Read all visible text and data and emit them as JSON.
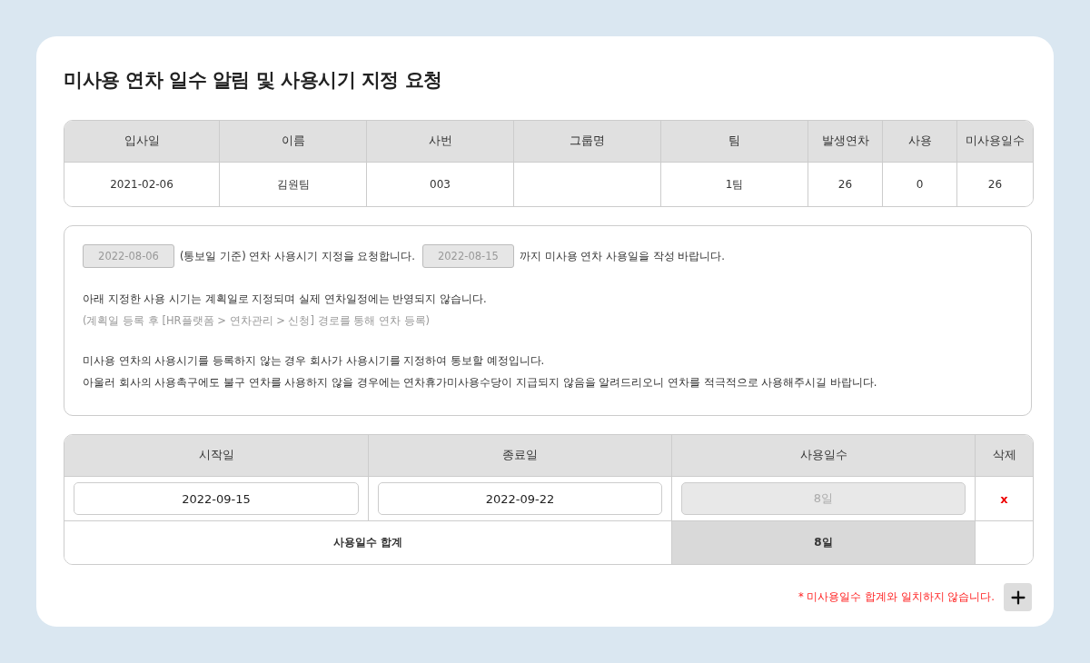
{
  "title": "미사용 연차 일수 알림 및 사용시기 지정 요청",
  "employee_table": {
    "columns": [
      "입사일",
      "이름",
      "사번",
      "그룹명",
      "팀",
      "발생연차",
      "사용",
      "미사용일수"
    ],
    "rows": [
      [
        "2021-02-06",
        "김원팀",
        "003",
        "",
        "1팀",
        "26",
        "0",
        "26"
      ]
    ]
  },
  "notice": {
    "request_line": {
      "notify_date": "2022-08-06",
      "text_1": "(통보일 기준) 연차 사용시기 지정을 요청합니다.",
      "deadline": "2022-08-15",
      "text_2": "까지 미사용 연차 사용일을 작성 바랍니다."
    },
    "groups": [
      {
        "lines": [
          {
            "text": "아래 지정한 사용 시기는 계획일로 지정되며 실제 연차일정에는 반영되지 않습니다.",
            "muted": false
          },
          {
            "text": "(계획일 등록 후 [HR플랫폼 > 연차관리 > 신청] 경로를 통해 연차 등록)",
            "muted": true
          }
        ]
      },
      {
        "lines": [
          {
            "text": "미사용 연차의 사용시기를 등록하지 않는 경우 회사가 사용시기를 지정하여 통보할 예정입니다.",
            "muted": false
          },
          {
            "text": "아울러 회사의 사용촉구에도 불구 연차를 사용하지 않을 경우에는 연차휴가미사용수당이 지급되지 않음을 알려드리오니 연차를 적극적으로 사용해주시길 바랍니다.",
            "muted": false
          }
        ]
      }
    ]
  },
  "usage_table": {
    "columns": [
      "시작일",
      "종료일",
      "사용일수",
      "삭제"
    ],
    "rows": [
      {
        "start": "2022-09-15",
        "end": "2022-09-22",
        "days": "8일",
        "days_disabled": true,
        "delete": "x"
      }
    ],
    "total": {
      "label": "사용일수 합계",
      "value": "8일"
    }
  },
  "warning": "* 미사용일수 합계와 일치하지 않습니다."
}
